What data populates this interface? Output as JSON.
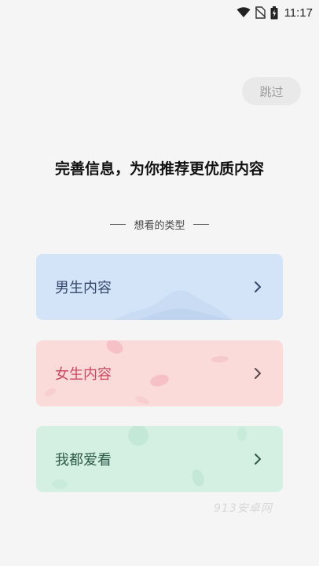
{
  "status_bar": {
    "time": "11:17",
    "icons": [
      "wifi-icon",
      "no-sim-icon",
      "battery-charging-icon"
    ]
  },
  "skip_label": "跳过",
  "headline": "完善信息，为你推荐更优质内容",
  "section_label": "想看的类型",
  "options": [
    {
      "label": "男生内容",
      "color": "#d4e4f8",
      "text_color": "#35476b"
    },
    {
      "label": "女生内容",
      "color": "#fbdada",
      "text_color": "#cc4a5e"
    },
    {
      "label": "我都爱看",
      "color": "#d4f0e2",
      "text_color": "#2e5a49"
    }
  ],
  "watermark": "913安卓网"
}
